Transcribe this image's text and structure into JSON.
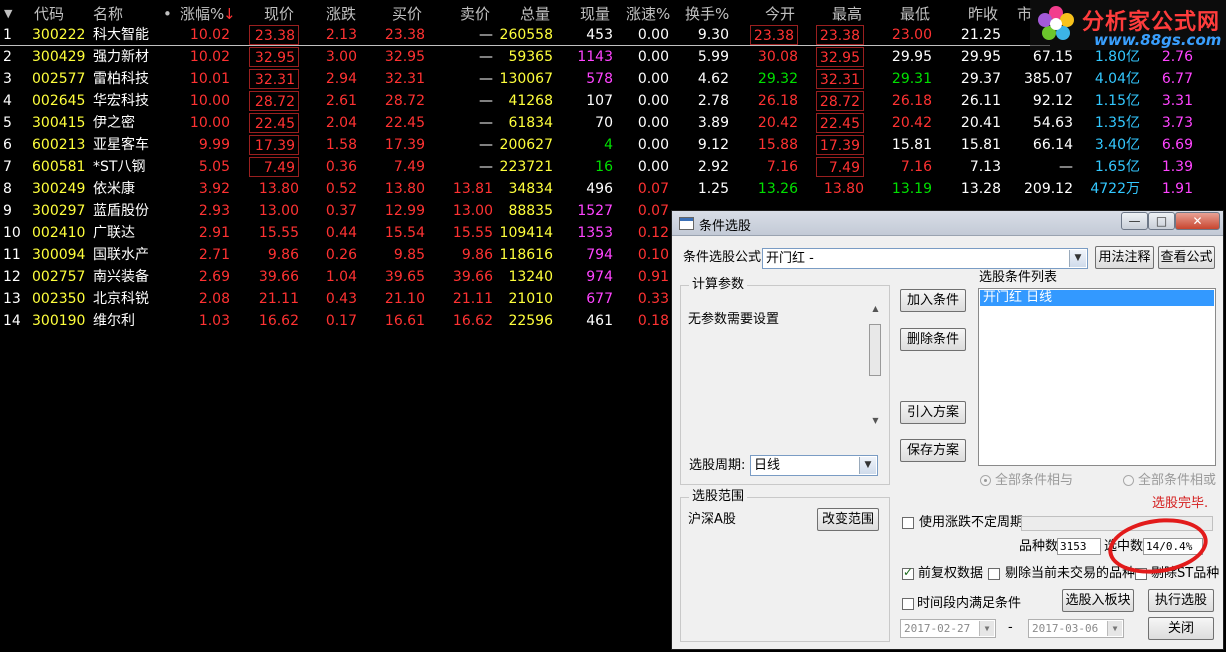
{
  "columns": {
    "sort_arrow": "▼",
    "code": "代码",
    "name": "名称",
    "name_dot": "•",
    "pct": "涨幅%",
    "pct_sort": "↓",
    "price": "现价",
    "chg": "涨跌",
    "bid": "买价",
    "ask": "卖价",
    "vol": "总量",
    "cur": "现量",
    "speed": "涨速%",
    "turnover": "换手%",
    "open": "今开",
    "high": "最高",
    "low": "最低",
    "prev": "昨收",
    "more": "市"
  },
  "rows": [
    {
      "n": "1",
      "code": "300222",
      "name": "科大智能",
      "pct": "10.02",
      "price": "23.38",
      "chg": "2.13",
      "bid": "23.38",
      "ask": "—",
      "vol": "260558",
      "cur": "453",
      "speed": "0.00",
      "to": "9.30",
      "open": "23.38",
      "high": "23.38",
      "low": "23.00",
      "prev": "21.25",
      "e1": "",
      "e2": "",
      "e3": ""
    },
    {
      "n": "2",
      "code": "300429",
      "name": "强力新材",
      "pct": "10.02",
      "price": "32.95",
      "chg": "3.00",
      "bid": "32.95",
      "ask": "—",
      "vol": "59365",
      "cur": "1143",
      "speed": "0.00",
      "to": "5.99",
      "open": "30.08",
      "high": "32.95",
      "low": "29.95",
      "prev": "29.95",
      "e1": "67.15",
      "e2": "1.80亿",
      "e3": "2.76"
    },
    {
      "n": "3",
      "code": "002577",
      "name": "雷柏科技",
      "pct": "10.01",
      "price": "32.31",
      "chg": "2.94",
      "bid": "32.31",
      "ask": "—",
      "vol": "130067",
      "cur": "578",
      "speed": "0.00",
      "to": "4.62",
      "open": "29.32",
      "high": "32.31",
      "low": "29.31",
      "prev": "29.37",
      "e1": "385.07",
      "e2": "4.04亿",
      "e3": "6.77"
    },
    {
      "n": "4",
      "code": "002645",
      "name": "华宏科技",
      "pct": "10.00",
      "price": "28.72",
      "chg": "2.61",
      "bid": "28.72",
      "ask": "—",
      "vol": "41268",
      "cur": "107",
      "speed": "0.00",
      "to": "2.78",
      "open": "26.18",
      "high": "28.72",
      "low": "26.18",
      "prev": "26.11",
      "e1": "92.12",
      "e2": "1.15亿",
      "e3": "3.31"
    },
    {
      "n": "5",
      "code": "300415",
      "name": "伊之密",
      "pct": "10.00",
      "price": "22.45",
      "chg": "2.04",
      "bid": "22.45",
      "ask": "—",
      "vol": "61834",
      "cur": "70",
      "speed": "0.00",
      "to": "3.89",
      "open": "20.42",
      "high": "22.45",
      "low": "20.42",
      "prev": "20.41",
      "e1": "54.63",
      "e2": "1.35亿",
      "e3": "3.73"
    },
    {
      "n": "6",
      "code": "600213",
      "name": "亚星客车",
      "pct": "9.99",
      "price": "17.39",
      "chg": "1.58",
      "bid": "17.39",
      "ask": "—",
      "vol": "200627",
      "cur": "4",
      "speed": "0.00",
      "to": "9.12",
      "open": "15.88",
      "high": "17.39",
      "low": "15.81",
      "prev": "15.81",
      "e1": "66.14",
      "e2": "3.40亿",
      "e3": "6.69"
    },
    {
      "n": "7",
      "code": "600581",
      "name": "*ST八钢",
      "pct": "5.05",
      "price": "7.49",
      "chg": "0.36",
      "bid": "7.49",
      "ask": "—",
      "vol": "223721",
      "cur": "16",
      "speed": "0.00",
      "to": "2.92",
      "open": "7.16",
      "high": "7.49",
      "low": "7.16",
      "prev": "7.13",
      "e1": "—",
      "e2": "1.65亿",
      "e3": "1.39"
    },
    {
      "n": "8",
      "code": "300249",
      "name": "依米康",
      "pct": "3.92",
      "price": "13.80",
      "chg": "0.52",
      "bid": "13.80",
      "ask": "13.81",
      "vol": "34834",
      "cur": "496",
      "speed": "0.07",
      "to": "1.25",
      "open": "13.26",
      "high": "13.80",
      "low": "13.19",
      "prev": "13.28",
      "e1": "209.12",
      "e2": "4722万",
      "e3": "1.91"
    },
    {
      "n": "9",
      "code": "300297",
      "name": "蓝盾股份",
      "pct": "2.93",
      "price": "13.00",
      "chg": "0.37",
      "bid": "12.99",
      "ask": "13.00",
      "vol": "88835",
      "cur": "1527",
      "speed": "0.07",
      "to": "",
      "open": "",
      "high": "",
      "low": "",
      "prev": "",
      "e1": "",
      "e2": "",
      "e3": ""
    },
    {
      "n": "10",
      "code": "002410",
      "name": "广联达",
      "pct": "2.91",
      "price": "15.55",
      "chg": "0.44",
      "bid": "15.54",
      "ask": "15.55",
      "vol": "109414",
      "cur": "1353",
      "speed": "0.12",
      "to": "",
      "open": "",
      "high": "",
      "low": "",
      "prev": "",
      "e1": "",
      "e2": "",
      "e3": ""
    },
    {
      "n": "11",
      "code": "300094",
      "name": "国联水产",
      "pct": "2.71",
      "price": "9.86",
      "chg": "0.26",
      "bid": "9.85",
      "ask": "9.86",
      "vol": "118616",
      "cur": "794",
      "speed": "0.10",
      "to": "",
      "open": "",
      "high": "",
      "low": "",
      "prev": "",
      "e1": "",
      "e2": "",
      "e3": ""
    },
    {
      "n": "12",
      "code": "002757",
      "name": "南兴装备",
      "pct": "2.69",
      "price": "39.66",
      "chg": "1.04",
      "bid": "39.65",
      "ask": "39.66",
      "vol": "13240",
      "cur": "974",
      "speed": "0.91",
      "to": "",
      "open": "",
      "high": "",
      "low": "",
      "prev": "",
      "e1": "",
      "e2": "",
      "e3": ""
    },
    {
      "n": "13",
      "code": "002350",
      "name": "北京科锐",
      "pct": "2.08",
      "price": "21.11",
      "chg": "0.43",
      "bid": "21.10",
      "ask": "21.11",
      "vol": "21010",
      "cur": "677",
      "speed": "0.33",
      "to": "",
      "open": "",
      "high": "",
      "low": "",
      "prev": "",
      "e1": "",
      "e2": "",
      "e3": ""
    },
    {
      "n": "14",
      "code": "300190",
      "name": "维尔利",
      "pct": "1.03",
      "price": "16.62",
      "chg": "0.17",
      "bid": "16.61",
      "ask": "16.62",
      "vol": "22596",
      "cur": "461",
      "speed": "0.18",
      "to": "",
      "open": "",
      "high": "",
      "low": "",
      "prev": "",
      "e1": "",
      "e2": "",
      "e3": ""
    }
  ],
  "colors": {
    "up": "#ff3232",
    "down": "#00e000",
    "flat": "#ffffff",
    "yellow": "#ffff3c",
    "magenta": "#ff44ff",
    "cyan": "#33c8ff",
    "header": "#c0c0c0"
  },
  "watermark": {
    "title": "分析家公式网",
    "url": "www.88gs.com"
  },
  "dialog": {
    "title": "条件选股",
    "min": "—",
    "max": "□",
    "close": "✕",
    "formula_label": "条件选股公式",
    "formula_value": "开门红        -",
    "usage_button": "用法注释",
    "view_button": "查看公式",
    "params_group": "计算参数",
    "params_text": "无参数需要设置",
    "period_label": "选股周期:",
    "period_value": "日线",
    "add_button": "加入条件",
    "delete_button": "删除条件",
    "import_button": "引入方案",
    "save_button": "保存方案",
    "cond_list_label": "选股条件列表",
    "cond_items": [
      "开门红  日线"
    ],
    "radio_and": "全部条件相与",
    "radio_or": "全部条件相或",
    "status": "选股完毕.",
    "range_group": "选股范围",
    "range_value": "沪深A股",
    "change_range_button": "改变范围",
    "variable_period_label": "使用涨跌不定周期",
    "count_label": "品种数",
    "count_value": "3153",
    "selected_label": "选中数",
    "selected_value": "14/0.4%",
    "adj_label": "前复权数据",
    "exclude_untraded_label": "剔除当前未交易的品种",
    "exclude_st_label": "剔除ST品种",
    "time_range_label": "时间段内满足条件",
    "start_date": "2017-02-27",
    "date_sep": "-",
    "end_date": "2017-03-06",
    "to_block_button": "选股入板块",
    "execute_button": "执行选股",
    "close_button": "关闭"
  }
}
